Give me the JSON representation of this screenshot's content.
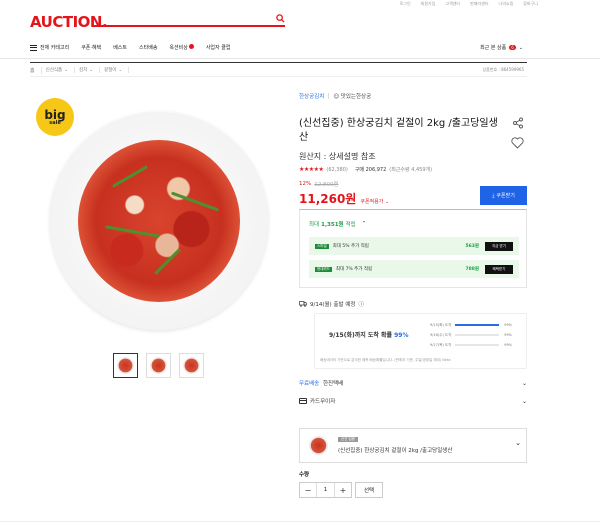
{
  "header": {
    "logo": "AUCTION.",
    "util_links": [
      "로그인",
      "회원가입",
      "고객센터",
      "판매자센터",
      "나의쇼핑",
      "장바구니"
    ],
    "search_placeholder": "",
    "nav": {
      "all_category": "전체 카테고리",
      "items": [
        "쿠폰·혜택",
        "베스트",
        "스타배송",
        "옥션비상",
        "사업자 클럽"
      ],
      "recent_label": "최근 본 상품",
      "recent_count": "6"
    }
  },
  "breadcrumb": {
    "home": "홈",
    "items": [
      "신선식품",
      "김치",
      "겉절이"
    ],
    "item_no": "상품번호 : 864599965"
  },
  "gallery": {
    "badge_line1": "big",
    "badge_line2": "sale",
    "thumb_count": 3
  },
  "product": {
    "store_name": "한상궁김치",
    "store_tag": "맛있는한상궁",
    "title": "(신선집중) 한상궁김치 겉절이 2kg /출고당일생산",
    "origin": "원산지 : 상세설명 참조",
    "rating_stars": "★★★★★",
    "review_count": "(62,380)",
    "buy_count": "구매 206,972",
    "buy_extra": "(최근수량 4,459개)",
    "discount_rate": "12%",
    "original_price": "12,800원",
    "price": "11,260원",
    "price_tag": "쿠폰적용가",
    "coupon_button": "쿠폰받기"
  },
  "benefit": {
    "prefix": "최대",
    "amount": "1,351원",
    "suffix": "적립",
    "rows": [
      {
        "logo": "스마일",
        "text": "최대 5% 추가 적립",
        "amount": "563원",
        "button": "지금 받기"
      },
      {
        "logo": "현대카드",
        "text": "최대 7% 추가 적립",
        "amount": "788원",
        "button": "혜택받기"
      }
    ]
  },
  "shipping": {
    "ship_date": "9/14(월) 출발 예정",
    "eta_main_prefix": "9/15(화)까지 도착 확률",
    "eta_main_pct": "99%",
    "eta_rows": [
      {
        "date": "9/15(화) 도착",
        "pct": "99%",
        "fill": 0.99
      },
      {
        "date": "9/16(수) 도착",
        "pct": "99%",
        "fill": 0.0
      },
      {
        "date": "9/17(목) 도착",
        "pct": "99%",
        "fill": 0.0
      }
    ],
    "eta_note": "배송데이터 기반으로 분석한 예측 배송확률입니다. (판매자 기준, 주말/공휴일 제외) Beta",
    "delivery_label": "무료배송",
    "delivery_value": "한진택배",
    "card_label": "카드무이자"
  },
  "selected": {
    "badge": "신선 집중",
    "name": "(신선집중) 한상궁김치 겉절이 2kg /출고당일생산"
  },
  "quantity": {
    "label": "수량",
    "value": "1",
    "select_button": "선택"
  }
}
